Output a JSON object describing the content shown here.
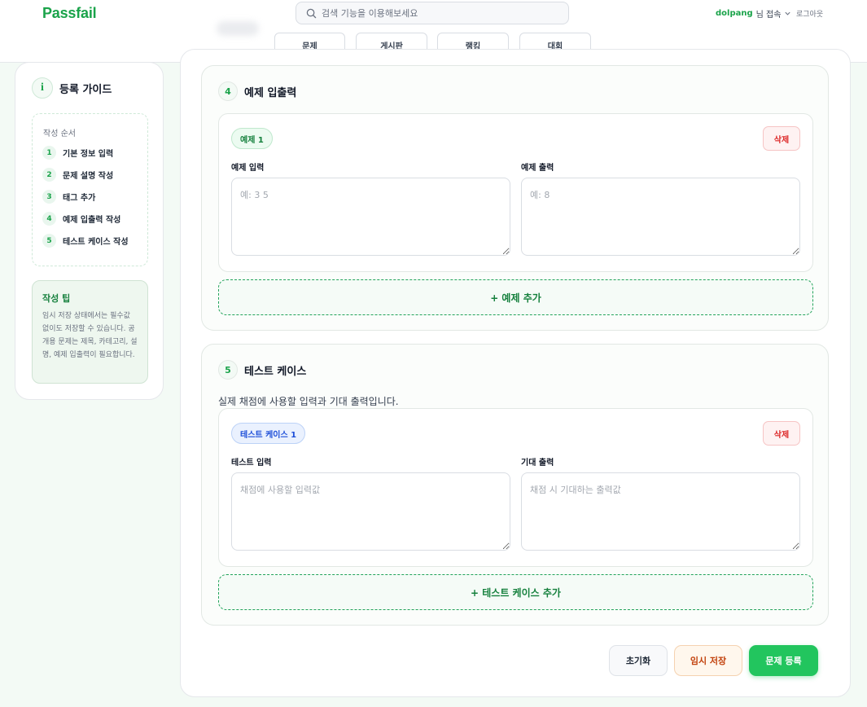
{
  "header": {
    "logo": "Passfail",
    "search_placeholder": "검색 기능을 이용해보세요",
    "user_name": "dolpang",
    "user_suffix": "님 접속",
    "logout": "로그아웃",
    "nav": [
      {
        "label": "문제"
      },
      {
        "label": "게시판"
      },
      {
        "label": "랭킹"
      },
      {
        "label": "대회"
      }
    ]
  },
  "sidebar": {
    "title": "등록 가이드",
    "info_glyph": "i",
    "steps_label": "작성 순서",
    "steps": [
      {
        "num": "1",
        "label": "기본 정보 입력"
      },
      {
        "num": "2",
        "label": "문제 설명 작성"
      },
      {
        "num": "3",
        "label": "태그 추가"
      },
      {
        "num": "4",
        "label": "예제 입출력 작성"
      },
      {
        "num": "5",
        "label": "테스트 케이스 작성"
      }
    ],
    "tip_title": "작성 팁",
    "tip_text": "임시 저장 상태에서는 필수값 없이도 저장할 수 있습니다. 공개용 문제는 제목, 카테고리, 설명, 예제 입출력이 필요합니다."
  },
  "examples": {
    "num": "4",
    "title": "예제 입출력",
    "item": {
      "badge": "예제 1",
      "delete": "삭제",
      "input_label": "예제 입력",
      "input_placeholder": "예: 3 5",
      "output_label": "예제 출력",
      "output_placeholder": "예: 8"
    },
    "add_label": "+ 예제 추가"
  },
  "testcases": {
    "num": "5",
    "title": "테스트 케이스",
    "description": "실제 채점에 사용할 입력과 기대 출력입니다.",
    "item": {
      "badge": "테스트 케이스 1",
      "delete": "삭제",
      "input_label": "테스트 입력",
      "input_placeholder": "채점에 사용할 입력값",
      "output_label": "기대 출력",
      "output_placeholder": "채점 시 기대하는 출력값"
    },
    "add_label": "+ 테스트 케이스 추가"
  },
  "actions": {
    "reset": "초기화",
    "draft": "임시 저장",
    "submit": "문제 등록"
  },
  "colors": {
    "brand": "#1aa34a",
    "submit": "#22c55e",
    "danger": "#dc2626",
    "draft": "#c2410c"
  }
}
